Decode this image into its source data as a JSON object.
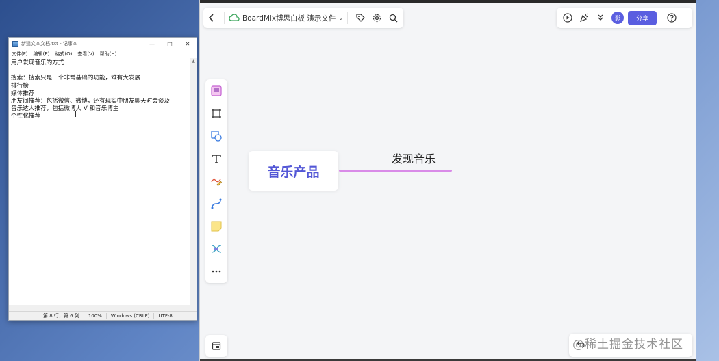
{
  "notepad": {
    "title": "新建文本文档.txt - 记事本",
    "menu": [
      "文件(F)",
      "编辑(E)",
      "格式(O)",
      "查看(V)",
      "帮助(H)"
    ],
    "content": "用户发现音乐的方式\n\n搜索：搜索只是一个非常基础的功能，难有大发展\n排行榜\n媒体推荐\n朋友间推荐：包括微信、微博，还有现实中朋友聊天时会谈及\n音乐达人推荐，包括微博大 V 和音乐博主\n个性化推荐",
    "status": {
      "position": "第 8 行，第 6 列",
      "zoom": "100%",
      "line_ending": "Windows (CRLF)",
      "encoding": "UTF-8"
    }
  },
  "board": {
    "file_name": "BoardMix博思白板 演示文件",
    "avatar_label": "影",
    "share_label": "分享",
    "mindmap": {
      "root": "音乐产品",
      "child": "发现音乐",
      "connector_color": "#d98be8"
    },
    "watermark": "@稀土掘金技术社区"
  },
  "colors": {
    "accent": "#5a5ee0",
    "root_text": "#5357d6"
  }
}
